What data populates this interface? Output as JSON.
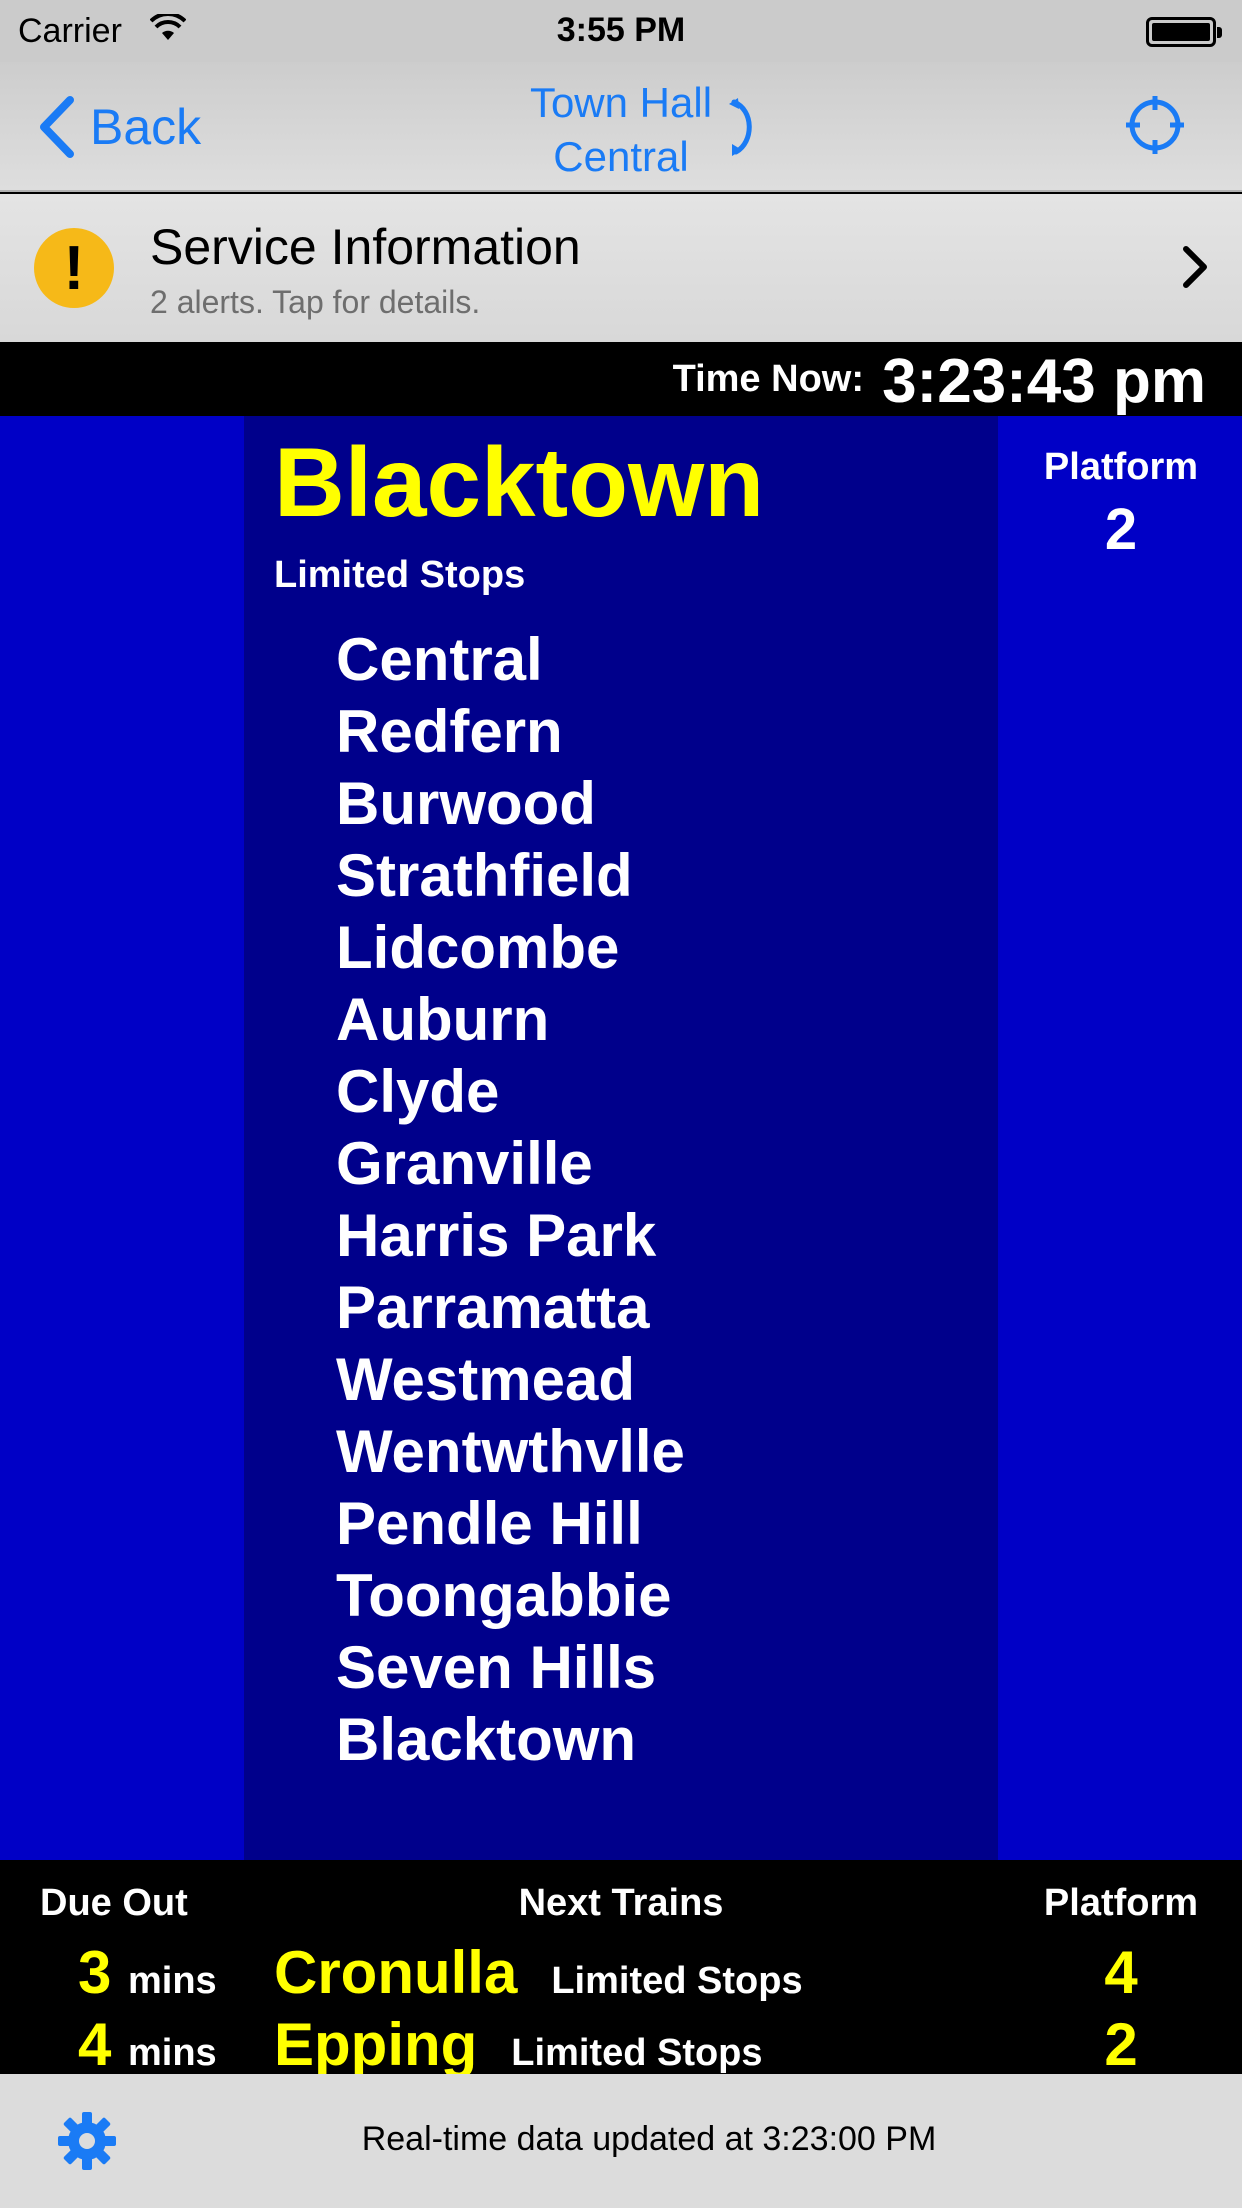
{
  "status_bar": {
    "carrier": "Carrier",
    "time": "3:55 PM"
  },
  "nav": {
    "back_label": "Back",
    "title_line1": "Town Hall",
    "title_line2": "Central",
    "accent_color": "#1a7bf5"
  },
  "service_info": {
    "title": "Service Information",
    "subtitle": "2 alerts. Tap for details.",
    "icon_glyph": "!",
    "icon_color": "#f6b918"
  },
  "time_now": {
    "label": "Time Now:",
    "value": "3:23:43 pm"
  },
  "board": {
    "destination": "Blacktown",
    "service_type": "Limited Stops",
    "platform_label": "Platform",
    "platform": "2",
    "stops": [
      "Central",
      "Redfern",
      "Burwood",
      "Strathfield",
      "Lidcombe",
      "Auburn",
      "Clyde",
      "Granville",
      "Harris Park",
      "Parramatta",
      "Westmead",
      "Wentwthvlle",
      "Pendle Hill",
      "Toongabbie",
      "Seven Hills",
      "Blacktown"
    ],
    "colors": {
      "board_bg": "#0000c6",
      "center_bg": "#00008b",
      "highlight": "#ffff00"
    }
  },
  "next_trains": {
    "headers": {
      "due_out": "Due Out",
      "next": "Next Trains",
      "platform": "Platform"
    },
    "rows": [
      {
        "mins": "3",
        "unit": "mins",
        "destination": "Cronulla",
        "service_type": "Limited Stops",
        "platform": "4"
      },
      {
        "mins": "4",
        "unit": "mins",
        "destination": "Epping",
        "service_type": "Limited Stops",
        "platform": "2"
      }
    ]
  },
  "footer": {
    "update_text": "Real-time data updated at 3:23:00 PM"
  }
}
